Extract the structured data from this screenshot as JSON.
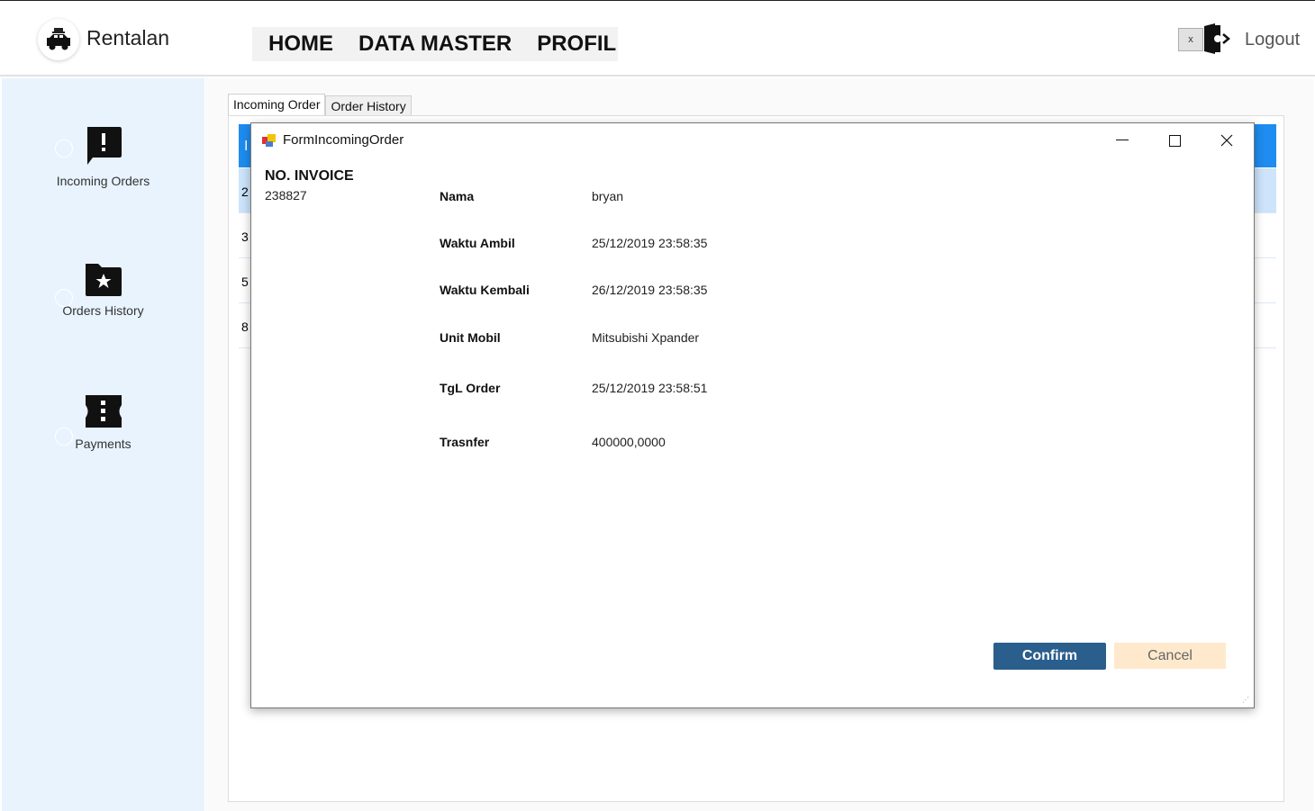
{
  "app": {
    "brand": "Rentalan",
    "logo_icon": "car-icon"
  },
  "nav": {
    "items": [
      "HOME",
      "DATA MASTER",
      "PROFIL"
    ]
  },
  "header": {
    "close_label": "x",
    "logout_label": "Logout",
    "logout_icon": "logout-door-icon"
  },
  "sidebar": {
    "items": [
      {
        "label": "Incoming Orders",
        "icon": "alert-message-icon"
      },
      {
        "label": "Orders History",
        "icon": "folder-star-icon"
      },
      {
        "label": "Payments",
        "icon": "ticket-icon"
      }
    ]
  },
  "tabs": [
    {
      "label": "Incoming Order",
      "active": true
    },
    {
      "label": "Order History",
      "active": false
    }
  ],
  "grid": {
    "header": "I",
    "rows": [
      "2",
      "3",
      "5",
      "8"
    ],
    "accent": "#1e8cf0"
  },
  "dialog": {
    "title": "FormIncomingOrder",
    "invoice_label": "NO. INVOICE",
    "invoice_value": "238827",
    "fields": [
      {
        "label": "Nama",
        "value": "bryan"
      },
      {
        "label": "Waktu Ambil",
        "value": "25/12/2019 23:58:35"
      },
      {
        "label": "Waktu Kembali",
        "value": "26/12/2019 23:58:35"
      },
      {
        "label": "Unit Mobil",
        "value": "Mitsubishi Xpander"
      },
      {
        "label": "TgL Order",
        "value": "25/12/2019 23:58:51"
      },
      {
        "label": "Trasnfer",
        "value": "400000,0000"
      }
    ],
    "confirm_label": "Confirm",
    "cancel_label": "Cancel",
    "confirm_color": "#2a5e8c",
    "cancel_color": "#ffe9cc"
  }
}
